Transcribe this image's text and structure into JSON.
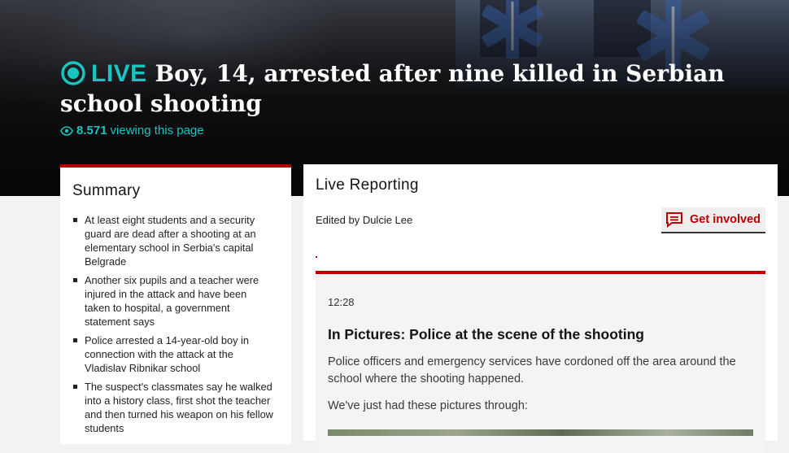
{
  "header": {
    "live_label": "LIVE",
    "headline": "Boy, 14, arrested after nine killed in Serbian school shooting",
    "viewer_count": "8.571",
    "viewer_suffix": "viewing this page",
    "accent_color": "#18c5c0"
  },
  "summary": {
    "title": "Summary",
    "items": [
      "At least eight students and a security guard are dead after a shooting at an elementary school in Serbia's capital Belgrade",
      "Another six pupils and a teacher were injured in the attack and have been taken to hospital, a government statement says",
      "Police arrested a 14-year-old boy in connection with the attack at the Vladislav Ribnikar school",
      "The suspect's classmates say he walked into a history class, first shot the teacher and then turned his weapon on his fellow students"
    ]
  },
  "live_reporting": {
    "title": "Live Reporting",
    "edited_by": "Edited by Dulcie Lee",
    "get_involved_label": "Get involved",
    "post": {
      "time": "12:28",
      "title": "In Pictures: Police at the scene of the shooting",
      "body": "Police officers and emergency services have cordoned off the area around the school where the shooting happened.",
      "body2": "We've just had these pictures through:"
    }
  },
  "colors": {
    "bbc_red": "#b80000",
    "hero_dark": "#141416"
  },
  "icons": {
    "live": "live-indicator-icon",
    "viewers": "eye-icon",
    "get_involved": "comment-icon"
  }
}
